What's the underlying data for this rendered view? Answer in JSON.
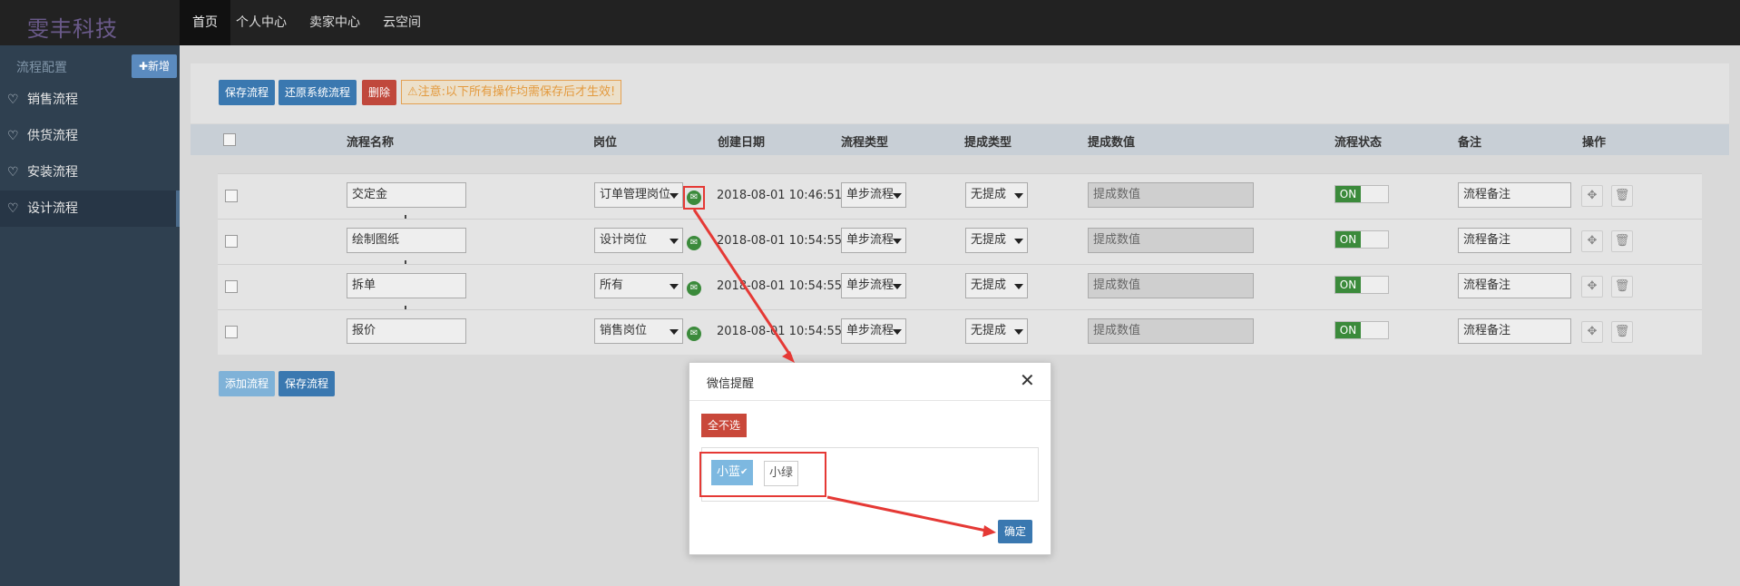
{
  "app": {
    "logo": "雯丰科技"
  },
  "nav": [
    {
      "label": "首页",
      "active": true
    },
    {
      "label": "个人中心"
    },
    {
      "label": "卖家中心"
    },
    {
      "label": "云空间"
    }
  ],
  "sidebar": {
    "title": "流程配置",
    "add_label": "新增",
    "items": [
      {
        "label": "销售流程",
        "icon": "heart-icon"
      },
      {
        "label": "供货流程",
        "icon": "heart-icon"
      },
      {
        "label": "安装流程",
        "icon": "heart-icon"
      },
      {
        "label": "设计流程",
        "icon": "heart-icon",
        "active": true
      }
    ]
  },
  "toolbar": {
    "save_label": "保存流程",
    "restore_label": "还原系统流程",
    "delete_label": "删除",
    "notice": "注意:以下所有操作均需保存后才生效!"
  },
  "table": {
    "headers": [
      "流程名称",
      "岗位",
      "创建日期",
      "流程类型",
      "提成类型",
      "提成数值",
      "流程状态",
      "备注",
      "操作"
    ],
    "rows": [
      {
        "name": "交定金",
        "position": "订单管理岗位",
        "date": "2018-08-01 10:46:51",
        "type": "单步流程",
        "commission_type": "无提成",
        "commission_value_placeholder": "提成数值",
        "status": "ON",
        "remark_placeholder": "流程备注"
      },
      {
        "name": "绘制图纸",
        "position": "设计岗位",
        "date": "2018-08-01 10:54:55",
        "type": "单步流程",
        "commission_type": "无提成",
        "commission_value_placeholder": "提成数值",
        "status": "ON",
        "remark_placeholder": "流程备注"
      },
      {
        "name": "拆单",
        "position": "所有",
        "date": "2018-08-01 10:54:55",
        "type": "单步流程",
        "commission_type": "无提成",
        "commission_value_placeholder": "提成数值",
        "status": "ON",
        "remark_placeholder": "流程备注"
      },
      {
        "name": "报价",
        "position": "销售岗位",
        "date": "2018-08-01 10:54:55",
        "type": "单步流程",
        "commission_type": "无提成",
        "commission_value_placeholder": "提成数值",
        "status": "ON",
        "remark_placeholder": "流程备注"
      }
    ]
  },
  "footer": {
    "add_label": "添加流程",
    "save_label": "保存流程"
  },
  "modal": {
    "title": "微信提醒",
    "close_glyph": "✕",
    "unselect_all_label": "全不选",
    "users": [
      {
        "label": "小蓝",
        "selected": true
      },
      {
        "label": "小绿",
        "selected": false
      }
    ],
    "confirm_label": "确定"
  },
  "colors": {
    "sidebar": "#2f4050",
    "topbar": "#222222",
    "primary": "#3a78b0",
    "danger": "#c0483c",
    "on": "#3b8a3b",
    "annotation": "#e53935"
  }
}
